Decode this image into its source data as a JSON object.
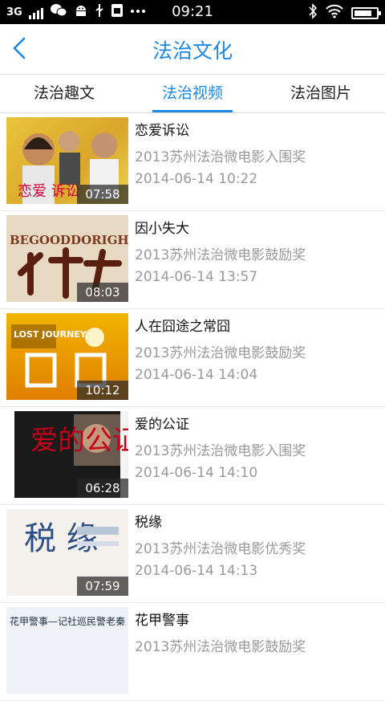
{
  "status_bar": {
    "network": "3G",
    "time": "09:21",
    "battery_level": 0.8,
    "icons": [
      "signal-icon",
      "wechat-icon",
      "android-icon",
      "usb-icon",
      "sim-icon",
      "more-icon",
      "bluetooth-icon",
      "wifi-icon",
      "battery-icon"
    ]
  },
  "header": {
    "title": "法治文化",
    "accent_color": "#1e88e5"
  },
  "tabs": [
    {
      "label": "法治趣文",
      "active": false
    },
    {
      "label": "法治视频",
      "active": true
    },
    {
      "label": "法治图片",
      "active": false
    }
  ],
  "videos": [
    {
      "title": "恋爱诉讼",
      "award": "2013苏州法治微电影入围奖",
      "date": "2014-06-14 10:22",
      "duration": "07:58",
      "thumb_text": "恋爱 诉讼"
    },
    {
      "title": "因小失大",
      "award": "2013苏州法治微电影鼓励奖",
      "date": "2014-06-14 13:57",
      "duration": "08:03",
      "thumb_text": "BEGOODDORIGHT"
    },
    {
      "title": "人在囧途之常囧",
      "award": "2013苏州法治微电影鼓励奖",
      "date": "2014-06-14 14:04",
      "duration": "10:12",
      "thumb_text": "LOST JOURNEY"
    },
    {
      "title": "爱的公证",
      "award": "2013苏州法治微电影入围奖",
      "date": "2014-06-14 14:10",
      "duration": "06:28",
      "thumb_text": "爱的公证"
    },
    {
      "title": "税缘",
      "award": "2013苏州法治微电影优秀奖",
      "date": "2014-06-14 14:13",
      "duration": "07:59",
      "thumb_text": "税 缘"
    },
    {
      "title": "花甲警事",
      "award": "2013苏州法治微电影鼓励奖",
      "date": "",
      "duration": "",
      "thumb_text": "花甲警事—记社巡民警老秦"
    }
  ]
}
